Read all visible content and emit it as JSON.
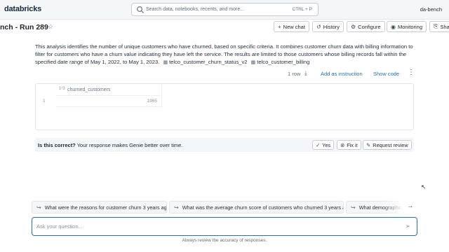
{
  "app": {
    "logo_text": "databricks",
    "user": "da-bench"
  },
  "search": {
    "placeholder": "Search data, notebooks, recents, and more...",
    "shortcut": "CTRL + P"
  },
  "page": {
    "title": "nch - Run 289"
  },
  "toolbar": {
    "new_chat": "New chat",
    "history": "History",
    "configure": "Configure",
    "monitoring": "Monitoring",
    "share": "Sha"
  },
  "answer": {
    "description": "This analysis identifies the number of unique customers who have churned, based on specific criteria. It combines customer churn data with billing information to filter for customers who have a churn value indicating they have left the service. The results are limited to those customers whose billing records fall within the specified date range of May 1, 2022, to May 1, 2023.",
    "tables": [
      "telco_customer_churn_status_v2",
      "telco_customer_billing"
    ],
    "row_count": "1 row",
    "add_as_instruction": "Add as instruction",
    "show_code": "Show code"
  },
  "result_table": {
    "column_type_icon": "1²3",
    "columns": [
      "churned_customers"
    ],
    "rows": [
      {
        "row_number": "1",
        "values": [
          "1965"
        ]
      }
    ]
  },
  "feedback": {
    "question": "Is this correct?",
    "note": "Your response makes Genie better over time.",
    "yes": "Yes",
    "fix_it": "Fix it",
    "request_review": "Request review"
  },
  "suggestions": [
    "What were the reasons for customer churn 3 years ago?",
    "What was the average churn score of customers who churned 3 years ago?",
    "What demographic c"
  ],
  "ask": {
    "placeholder": "Ask your question..."
  },
  "footer": {
    "text": "Always review the accuracy of responses."
  },
  "icons": {
    "search": "search-icon",
    "star": "star-icon",
    "plus": "plus-icon",
    "history": "history-icon",
    "gear": "gear-icon",
    "monitor": "eye-icon",
    "share": "share-icon",
    "table": "table-icon",
    "download": "download-icon",
    "kebab": "kebab-menu-icon",
    "check": "check-circle-icon",
    "close": "x-circle-icon",
    "comment": "comment-icon",
    "suggestion": "reply-arrow-icon",
    "next": "arrow-right-icon",
    "send": "send-icon",
    "cursor": "mouse-cursor-icon"
  },
  "colors": {
    "accent": "#2272b4",
    "topbar_bg": "#f5f6f7",
    "muted_text": "#5f6b77"
  }
}
